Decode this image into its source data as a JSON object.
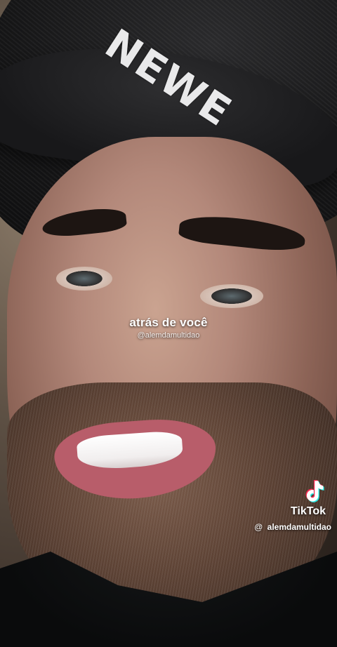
{
  "video": {
    "cap_text": "NEWE",
    "caption_title": "atrás de você",
    "caption_handle": "@alemdamultidao"
  },
  "watermark": {
    "icon": "tiktok-logo-icon",
    "brand": "TikTok",
    "at_symbol": "@",
    "username": "alemdamultidao"
  },
  "colors": {
    "tiktok_cyan": "#25F4EE",
    "tiktok_pink": "#FE2C55"
  }
}
